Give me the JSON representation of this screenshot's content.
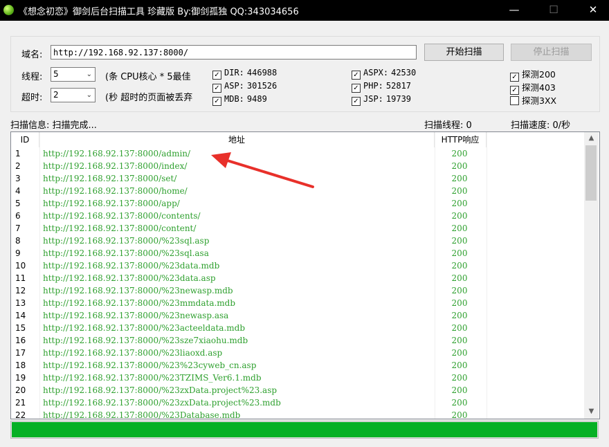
{
  "window": {
    "title": "《想念初恋》御剑后台扫描工具 珍藏版 By:御剑孤独 QQ:343034656",
    "minimize": "—",
    "maximize": "☐",
    "close": "✕"
  },
  "form": {
    "domain_label": "域名:",
    "domain_value": "http://192.168.92.137:8000/",
    "start_button": "开始扫描",
    "stop_button": "停止扫描",
    "threads_label": "线程:",
    "threads_value": "5",
    "threads_note": "(条 CPU核心 * 5最佳",
    "timeout_label": "超时:",
    "timeout_value": "2",
    "timeout_note": "(秒 超时的页面被丢弃"
  },
  "dictionaries": [
    {
      "label": "DIR:",
      "count": "446988",
      "checked": true
    },
    {
      "label": "ASP:",
      "count": "301526",
      "checked": true
    },
    {
      "label": "MDB:",
      "count": "9489",
      "checked": true
    },
    {
      "label": "ASPX:",
      "count": "42530",
      "checked": true
    },
    {
      "label": "PHP:",
      "count": "52817",
      "checked": true
    },
    {
      "label": "JSP:",
      "count": "19739",
      "checked": true
    }
  ],
  "probes": [
    {
      "label": "探测200",
      "checked": true
    },
    {
      "label": "探测403",
      "checked": true
    },
    {
      "label": "探测3XX",
      "checked": false
    }
  ],
  "status": {
    "info": "扫描信息: 扫描完成...",
    "threads": "扫描线程: 0",
    "speed": "扫描速度: 0/秒"
  },
  "table": {
    "columns": [
      "ID",
      "地址",
      "HTTP响应"
    ],
    "rows": [
      [
        "1",
        "http://192.168.92.137:8000/admin/",
        "200"
      ],
      [
        "2",
        "http://192.168.92.137:8000/index/",
        "200"
      ],
      [
        "3",
        "http://192.168.92.137:8000/set/",
        "200"
      ],
      [
        "4",
        "http://192.168.92.137:8000/home/",
        "200"
      ],
      [
        "5",
        "http://192.168.92.137:8000/app/",
        "200"
      ],
      [
        "6",
        "http://192.168.92.137:8000/contents/",
        "200"
      ],
      [
        "7",
        "http://192.168.92.137:8000/content/",
        "200"
      ],
      [
        "8",
        "http://192.168.92.137:8000/%23sql.asp",
        "200"
      ],
      [
        "9",
        "http://192.168.92.137:8000/%23sql.asa",
        "200"
      ],
      [
        "10",
        "http://192.168.92.137:8000/%23data.mdb",
        "200"
      ],
      [
        "11",
        "http://192.168.92.137:8000/%23data.asp",
        "200"
      ],
      [
        "12",
        "http://192.168.92.137:8000/%23newasp.mdb",
        "200"
      ],
      [
        "13",
        "http://192.168.92.137:8000/%23mmdata.mdb",
        "200"
      ],
      [
        "14",
        "http://192.168.92.137:8000/%23newasp.asa",
        "200"
      ],
      [
        "15",
        "http://192.168.92.137:8000/%23acteeldata.mdb",
        "200"
      ],
      [
        "16",
        "http://192.168.92.137:8000/%23sze7xiaohu.mdb",
        "200"
      ],
      [
        "17",
        "http://192.168.92.137:8000/%23liaoxd.asp",
        "200"
      ],
      [
        "18",
        "http://192.168.92.137:8000/%23%23cyweb_cn.asp",
        "200"
      ],
      [
        "19",
        "http://192.168.92.137:8000/%23TZIMS_Ver6.1.mdb",
        "200"
      ],
      [
        "20",
        "http://192.168.92.137:8000/%23zxData.project%23.asp",
        "200"
      ],
      [
        "21",
        "http://192.168.92.137:8000/%23zxData.project%23.mdb",
        "200"
      ],
      [
        "22",
        "http://192.168.92.137:8000/%23Database.mdb",
        "200"
      ]
    ]
  },
  "progress": {
    "fraction": 1.0
  }
}
